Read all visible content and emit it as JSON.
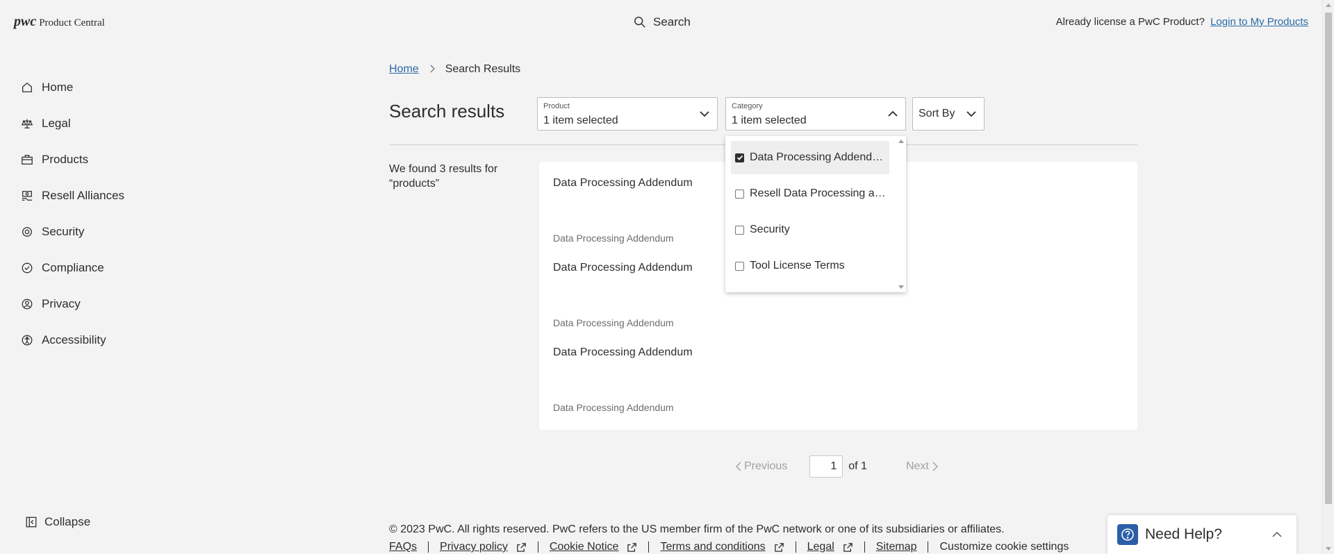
{
  "header": {
    "logo_mark": "pwc",
    "logo_text": "Product Central",
    "search_label": "Search",
    "login_prompt": "Already license a PwC Product?",
    "login_link": "Login to My Products"
  },
  "sidebar": {
    "items": [
      {
        "label": "Home",
        "icon": "home-icon"
      },
      {
        "label": "Legal",
        "icon": "scales-icon"
      },
      {
        "label": "Products",
        "icon": "briefcase-icon"
      },
      {
        "label": "Resell Alliances",
        "icon": "handshake-icon"
      },
      {
        "label": "Security",
        "icon": "shield-icon"
      },
      {
        "label": "Compliance",
        "icon": "check-circle-icon"
      },
      {
        "label": "Privacy",
        "icon": "user-lock-icon"
      },
      {
        "label": "Accessibility",
        "icon": "accessibility-icon"
      }
    ],
    "collapse_label": "Collapse"
  },
  "breadcrumb": {
    "home": "Home",
    "current": "Search Results"
  },
  "main": {
    "title": "Search results",
    "found_prefix": "We found",
    "found_count": "3",
    "found_suffix": "results for",
    "query": "“products”"
  },
  "filters": {
    "product": {
      "label": "Product",
      "value": "1 item selected"
    },
    "category": {
      "label": "Category",
      "value": "1 item selected"
    },
    "sort": {
      "value": "Sort By"
    }
  },
  "category_options": [
    {
      "label": "Data Processing Addendum",
      "checked": true
    },
    {
      "label": "Resell Data Processing addendum",
      "checked": false
    },
    {
      "label": "Security",
      "checked": false
    },
    {
      "label": "Tool License Terms",
      "checked": false
    }
  ],
  "results": [
    {
      "title": "Data Processing Addendum",
      "category": "Data Processing Addendum"
    },
    {
      "title": "Data Processing Addendum",
      "category": "Data Processing Addendum"
    },
    {
      "title": "Data Processing Addendum",
      "category": "Data Processing Addendum"
    }
  ],
  "pagination": {
    "previous": "Previous",
    "page": "1",
    "of": "of 1",
    "next": "Next"
  },
  "footer": {
    "copyright": "© 2023 PwC. All rights reserved. PwC refers to the US member firm of the PwC network or one of its subsidiaries or affiliates.",
    "links": {
      "faqs": "FAQs",
      "privacy": "Privacy policy",
      "cookie": "Cookie Notice",
      "terms": "Terms and conditions",
      "legal": "Legal",
      "sitemap": "Sitemap",
      "customize": "Customize cookie settings"
    }
  },
  "help": {
    "label": "Need Help?"
  },
  "colors": {
    "link": "#2b6aa6",
    "help_icon_bg": "#2b5ea7",
    "page_bg": "#f3f3f3"
  }
}
